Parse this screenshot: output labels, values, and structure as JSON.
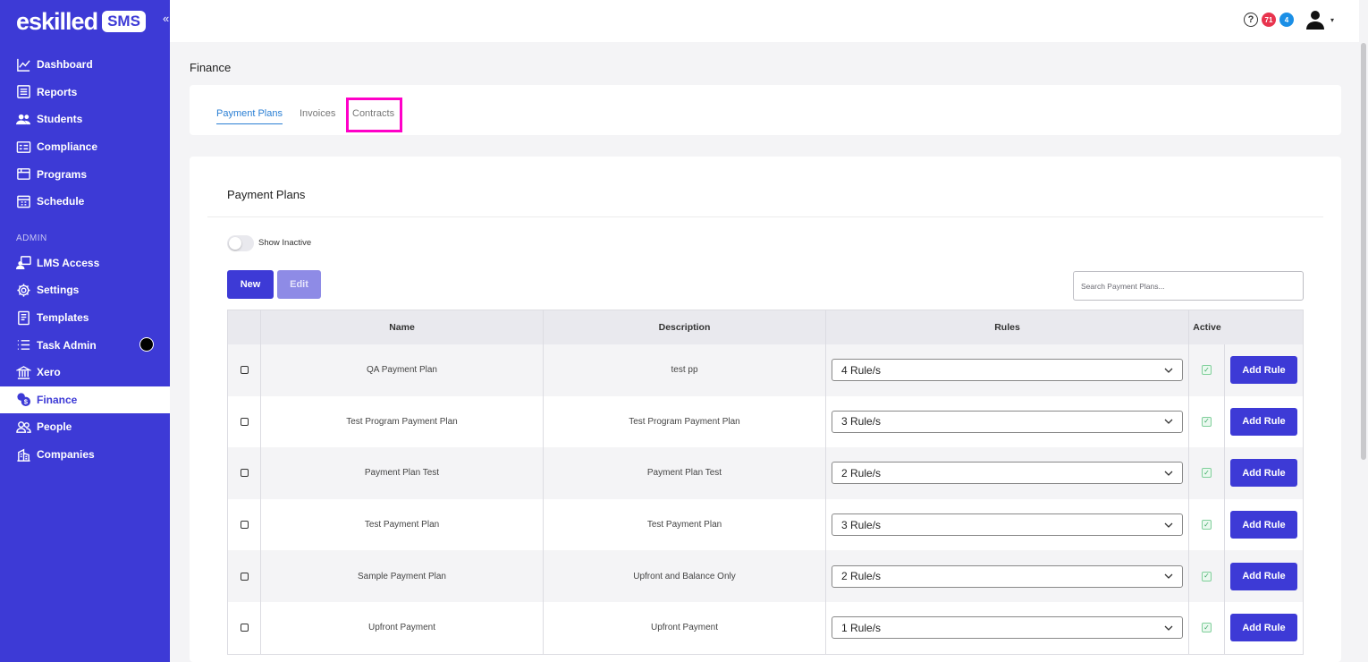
{
  "app": {
    "logo_text": "eskilled",
    "logo_badge": "SMS",
    "collapse_glyph": "«"
  },
  "sidebar": {
    "items": [
      {
        "label": "Dashboard",
        "icon": "chart-line-icon"
      },
      {
        "label": "Reports",
        "icon": "report-icon"
      },
      {
        "label": "Students",
        "icon": "students-icon"
      },
      {
        "label": "Compliance",
        "icon": "compliance-icon"
      },
      {
        "label": "Programs",
        "icon": "programs-icon"
      },
      {
        "label": "Schedule",
        "icon": "calendar-icon"
      }
    ],
    "admin_label": "ADMIN",
    "admin_items": [
      {
        "label": "LMS Access",
        "icon": "lms-icon"
      },
      {
        "label": "Settings",
        "icon": "gear-icon"
      },
      {
        "label": "Templates",
        "icon": "template-icon"
      },
      {
        "label": "Task Admin",
        "icon": "list-icon"
      },
      {
        "label": "Xero",
        "icon": "bank-icon"
      },
      {
        "label": "Finance",
        "icon": "finance-icon",
        "active": true
      },
      {
        "label": "People",
        "icon": "people-icon"
      },
      {
        "label": "Companies",
        "icon": "building-icon"
      }
    ]
  },
  "topbar": {
    "help_glyph": "?",
    "notif_red": "71",
    "notif_blue": "4",
    "caret": "▾"
  },
  "page": {
    "title": "Finance"
  },
  "tabs": [
    {
      "label": "Payment Plans",
      "active": true
    },
    {
      "label": "Invoices"
    },
    {
      "label": "Contracts"
    }
  ],
  "card": {
    "title": "Payment Plans",
    "toggle_label": "Show Inactive",
    "new_label": "New",
    "edit_label": "Edit",
    "search_placeholder": "Search Payment Plans..."
  },
  "table": {
    "headers": {
      "name": "Name",
      "description": "Description",
      "rules": "Rules",
      "active": "Active"
    },
    "add_rule_label": "Add Rule",
    "rows": [
      {
        "name": "QA Payment Plan",
        "description": "test pp",
        "rules": "4 Rule/s"
      },
      {
        "name": "Test Program Payment Plan",
        "description": "Test Program Payment Plan",
        "rules": "3 Rule/s"
      },
      {
        "name": "Payment Plan Test",
        "description": "Payment Plan Test",
        "rules": "2 Rule/s"
      },
      {
        "name": "Test Payment Plan",
        "description": "Test Payment Plan",
        "rules": "3 Rule/s"
      },
      {
        "name": "Sample Payment Plan",
        "description": "Upfront and Balance Only",
        "rules": "2 Rule/s"
      },
      {
        "name": "Upfront Payment",
        "description": "Upfront Payment",
        "rules": "1 Rule/s"
      }
    ]
  },
  "colors": {
    "brand": "#3d3ad6",
    "highlight": "#ff00c8",
    "tab_active": "#2a7fd4"
  }
}
